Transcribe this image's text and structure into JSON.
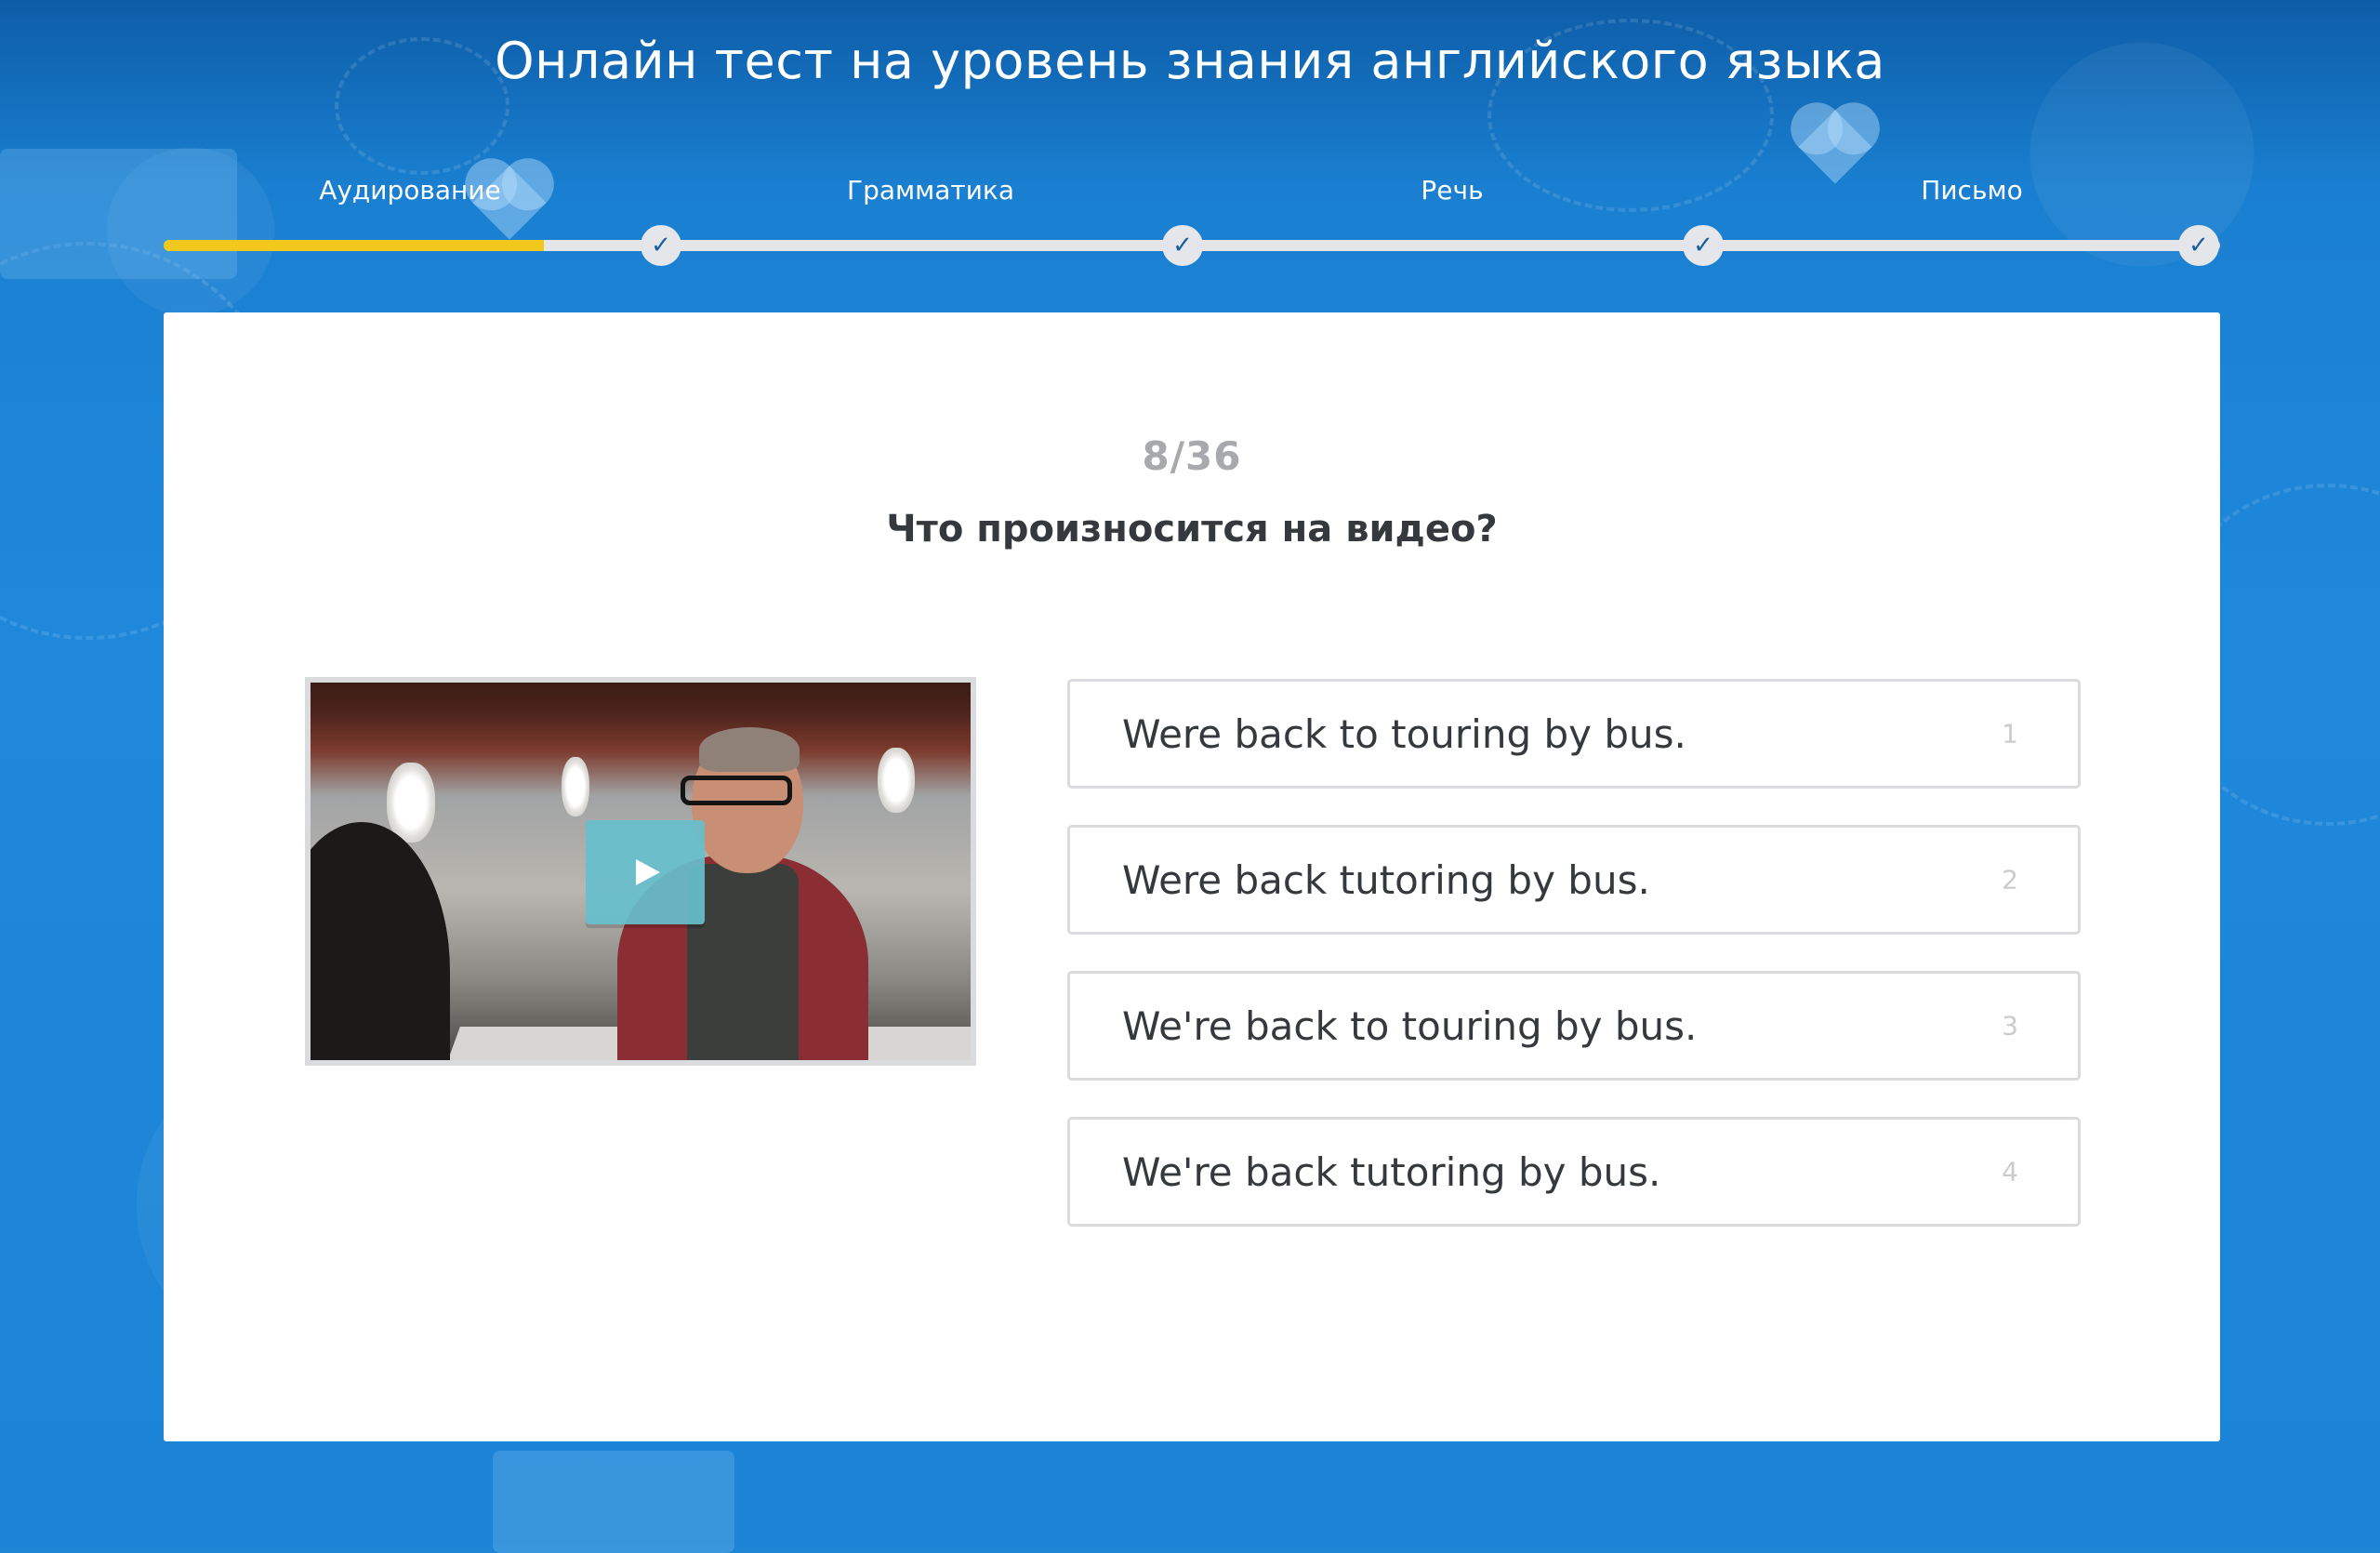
{
  "header": {
    "title": "Онлайн тест на уровень знания английского языка"
  },
  "progress": {
    "fill_fraction": 0.185,
    "steps": [
      {
        "label": "Аудирование",
        "done": true
      },
      {
        "label": "Грамматика",
        "done": true
      },
      {
        "label": "Речь",
        "done": true
      },
      {
        "label": "Письмо",
        "done": true
      }
    ],
    "check_icon": "check-icon"
  },
  "question": {
    "counter": "8/36",
    "text": "Что произносится на видео?"
  },
  "video": {
    "play_icon": "play-icon"
  },
  "answers": [
    {
      "text": "Were back to touring by bus.",
      "number": "1"
    },
    {
      "text": "Were back tutoring by bus.",
      "number": "2"
    },
    {
      "text": "We're back to touring by bus.",
      "number": "3"
    },
    {
      "text": "We're back tutoring by bus.",
      "number": "4"
    }
  ],
  "colors": {
    "background": "#1f86d6",
    "progress_fill": "#f2c81e",
    "progress_track": "#e4e6ea",
    "check": "#185da0",
    "play_button": "#66bfcc"
  }
}
